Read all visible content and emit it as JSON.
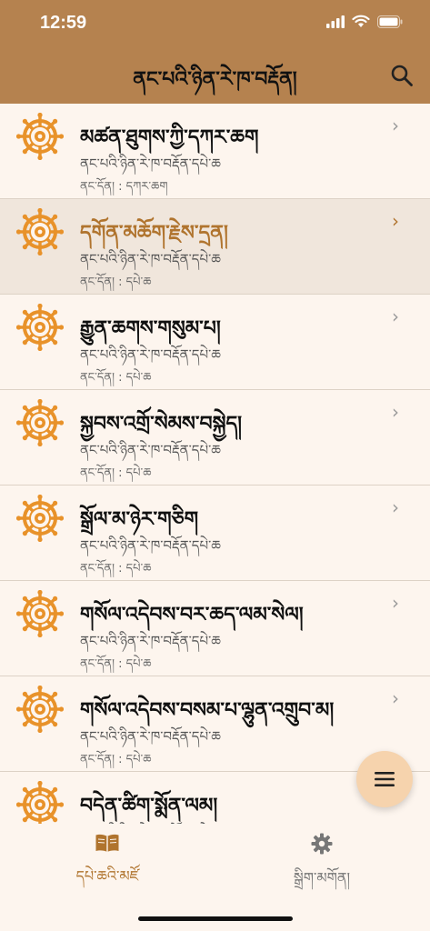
{
  "status": {
    "time": "12:59"
  },
  "header": {
    "title": "ནང་པའི་ཉིན་རེ་ཁ་བརྡོན།"
  },
  "colors": {
    "accent": "#b0742e",
    "header_bg": "#b5824f",
    "wheel": "#e8922a"
  },
  "list": {
    "items": [
      {
        "title": "མཚན་ཐུགས་ཀྱི་དཀར་ཆག",
        "subtitle": "ནང་པའི་ཉིན་རེ་ཁ་བརྡོན་དཔེ་ཆ",
        "meta": "ནང་དོན། : དཀར་ཆག",
        "selected": false
      },
      {
        "title": "དགོན་མཆོག་རྗེས་དྲན།",
        "subtitle": "ནང་པའི་ཉིན་རེ་ཁ་བརྡོན་དཔེ་ཆ",
        "meta": "ནང་དོན། : དཔེ་ཆ",
        "selected": true
      },
      {
        "title": "རྒྱུན་ཆགས་གསུམ་པ།",
        "subtitle": "ནང་པའི་ཉིན་རེ་ཁ་བརྡོན་དཔེ་ཆ",
        "meta": "ནང་དོན། : དཔེ་ཆ",
        "selected": false
      },
      {
        "title": "སྐྱབས་འགྲོ་སེམས་བསྐྱེད།",
        "subtitle": "ནང་པའི་ཉིན་རེ་ཁ་བརྡོན་དཔེ་ཆ",
        "meta": "ནང་དོན། : དཔེ་ཆ",
        "selected": false
      },
      {
        "title": "སྒྲོལ་མ་ཉེར་གཅིག",
        "subtitle": "ནང་པའི་ཉིན་རེ་ཁ་བརྡོན་དཔེ་ཆ",
        "meta": "ནང་དོན། : དཔེ་ཆ",
        "selected": false
      },
      {
        "title": "གསོལ་འདེབས་བར་ཆད་ལམ་སེལ།",
        "subtitle": "ནང་པའི་ཉིན་རེ་ཁ་བརྡོན་དཔེ་ཆ",
        "meta": "ནང་དོན། : དཔེ་ཆ",
        "selected": false
      },
      {
        "title": "གསོལ་འདེབས་བསམ་པ་ལྷུན་འགྲུབ་མ།",
        "subtitle": "ནང་པའི་ཉིན་རེ་ཁ་བརྡོན་དཔེ་ཆ",
        "meta": "ནང་དོན། : དཔེ་ཆ",
        "selected": false
      },
      {
        "title": "བདེན་ཚིག་སྨོན་ལམ།",
        "subtitle": "ནང་པའི་ཉིན་རེ་ཁ་བརྡོན་དཔེ་ཆ",
        "meta": "",
        "selected": false
      }
    ]
  },
  "tabs": {
    "home": {
      "label": "དཔེ་ཆའི་མཛོ",
      "icon": "book-icon"
    },
    "settings": {
      "label": "སྒྲིག་མགོན།",
      "icon": "gear-icon"
    }
  }
}
